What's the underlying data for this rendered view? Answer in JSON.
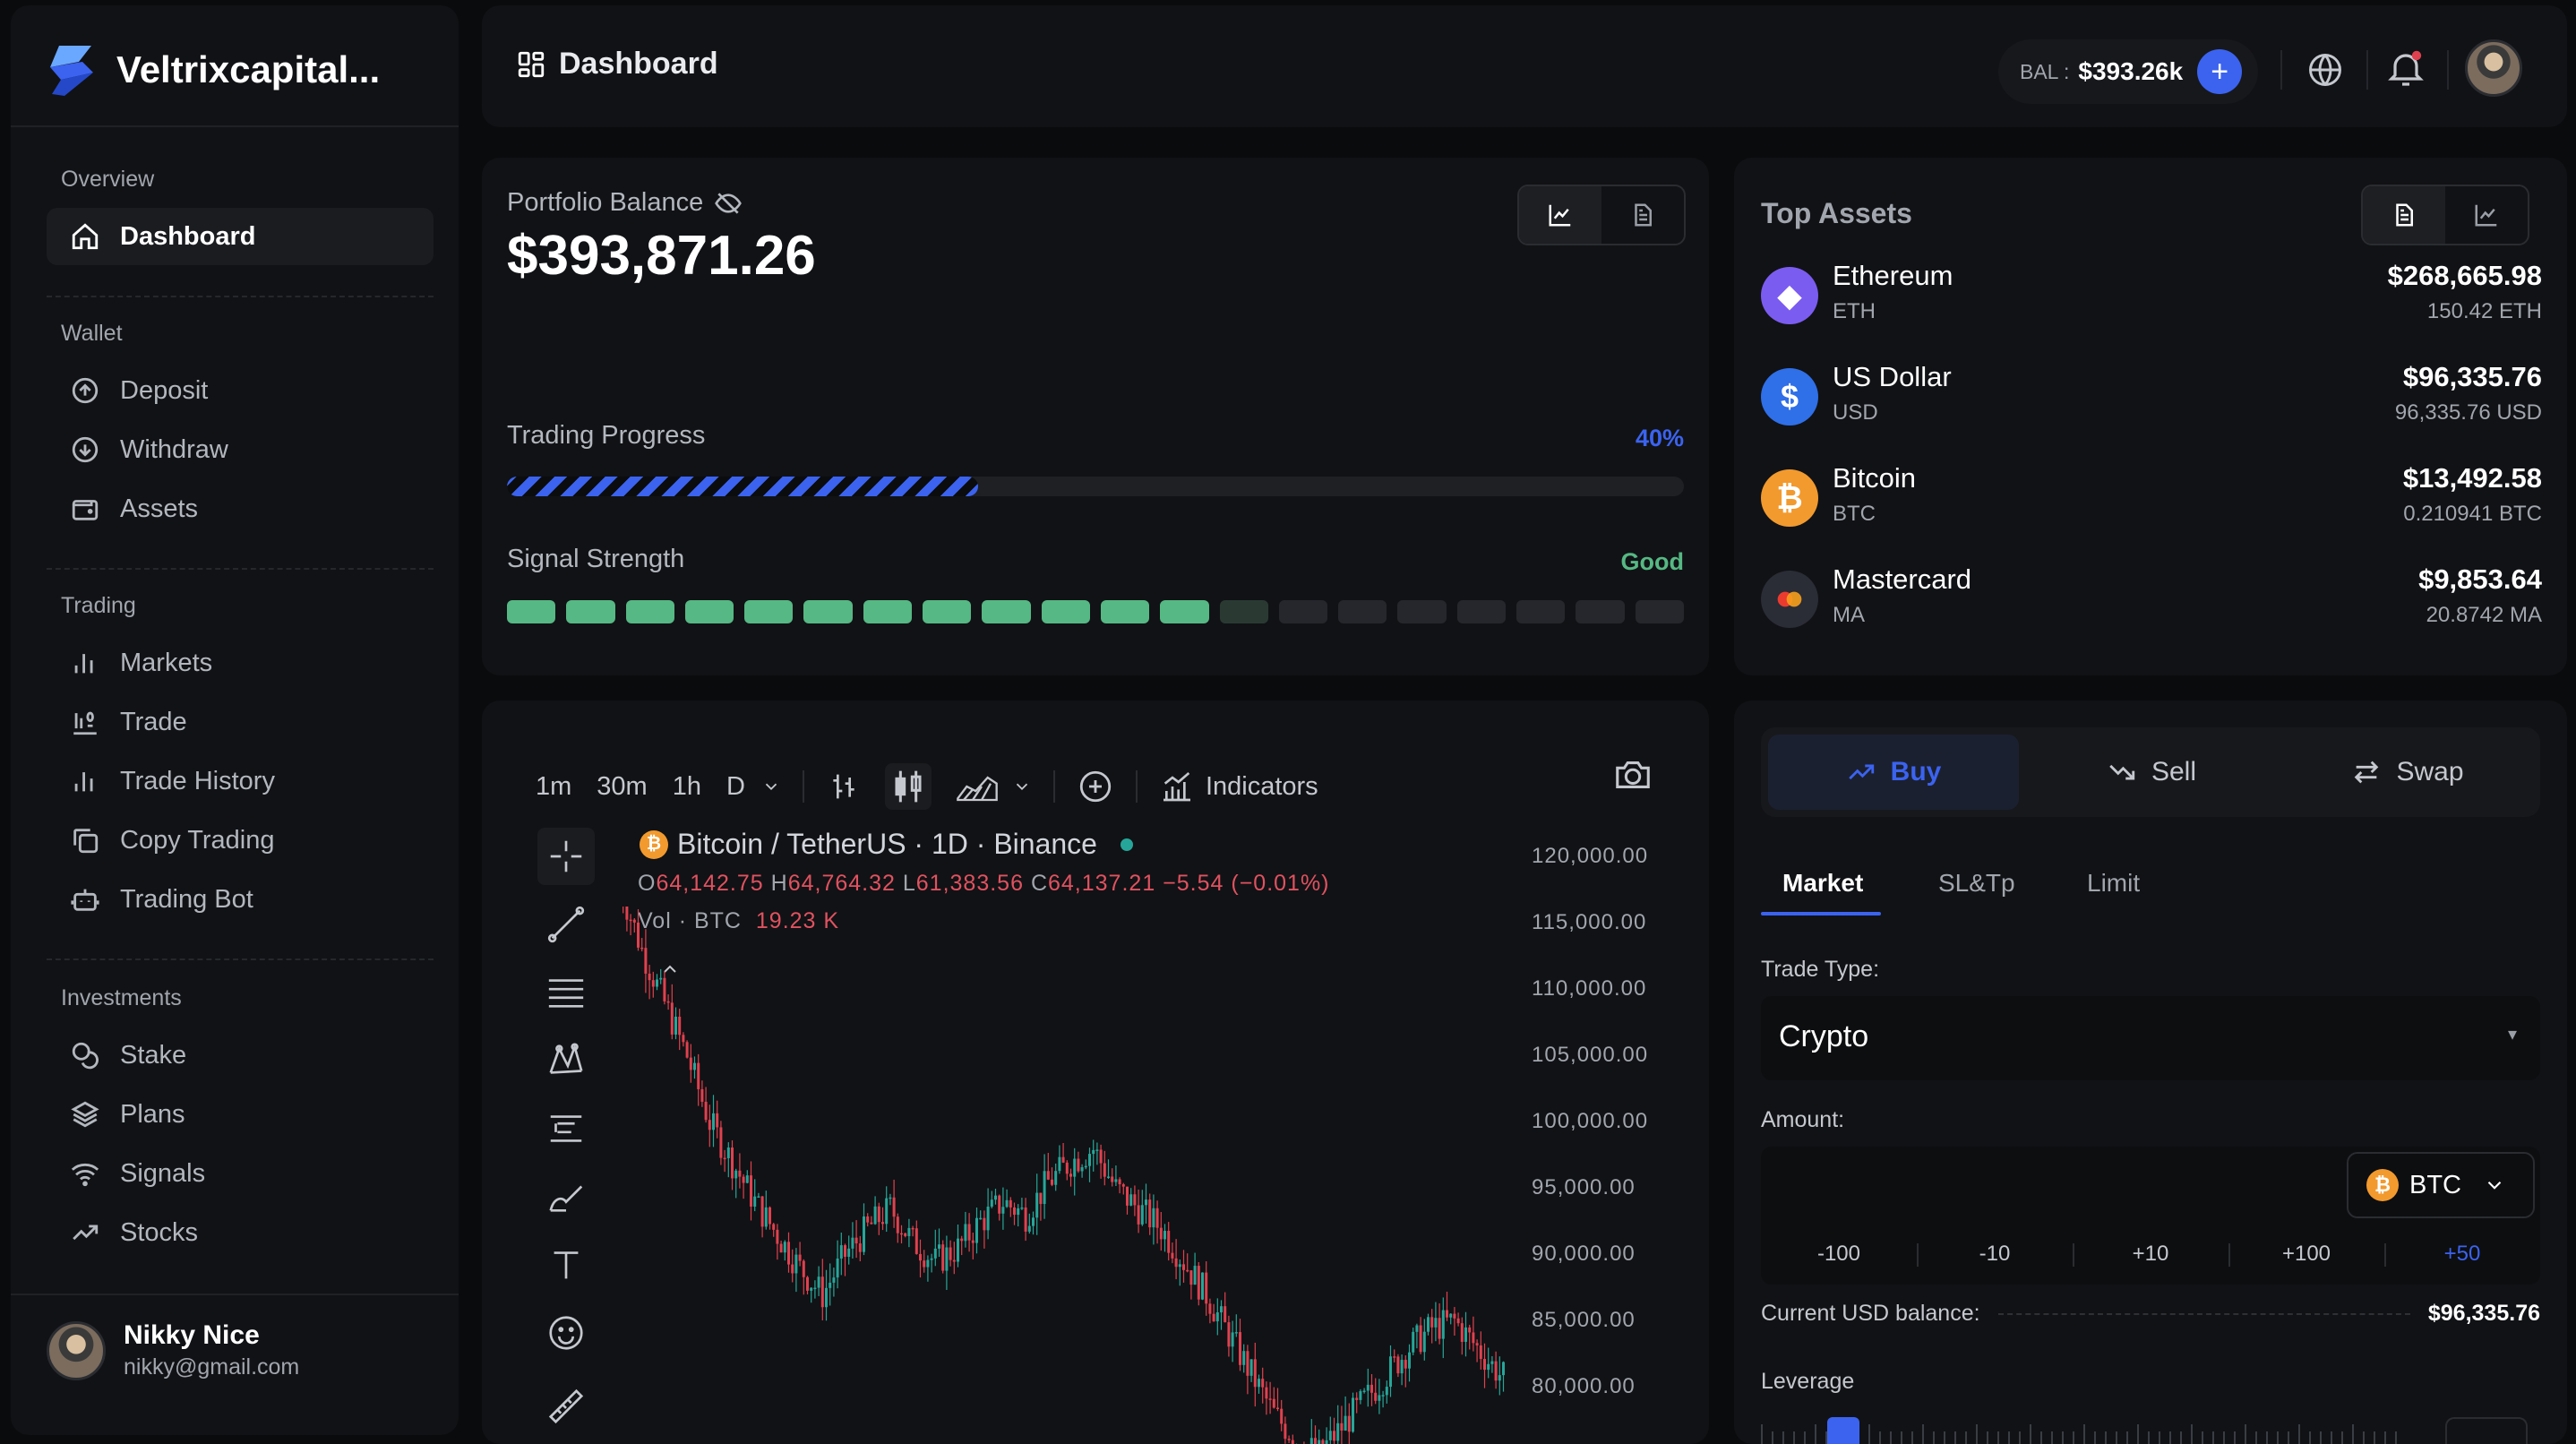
{
  "brand": {
    "name": "Veltrixcapital..."
  },
  "sidebar": {
    "sections": [
      {
        "title": "Overview",
        "items": [
          {
            "label": "Dashboard",
            "icon": "home-icon",
            "active": true
          }
        ]
      },
      {
        "title": "Wallet",
        "items": [
          {
            "label": "Deposit",
            "icon": "deposit-icon"
          },
          {
            "label": "Withdraw",
            "icon": "withdraw-icon"
          },
          {
            "label": "Assets",
            "icon": "wallet-icon"
          }
        ]
      },
      {
        "title": "Trading",
        "items": [
          {
            "label": "Markets",
            "icon": "bar-chart-icon"
          },
          {
            "label": "Trade",
            "icon": "trade-icon"
          },
          {
            "label": "Trade History",
            "icon": "bar-chart-icon"
          },
          {
            "label": "Copy Trading",
            "icon": "copy-icon"
          },
          {
            "label": "Trading Bot",
            "icon": "robot-icon"
          }
        ]
      },
      {
        "title": "Investments",
        "items": [
          {
            "label": "Stake",
            "icon": "coins-icon"
          },
          {
            "label": "Plans",
            "icon": "layers-icon"
          },
          {
            "label": "Signals",
            "icon": "wifi-icon"
          },
          {
            "label": "Stocks",
            "icon": "trending-up-icon"
          }
        ]
      }
    ],
    "user": {
      "name": "Nikky Nice",
      "email": "nikky@gmail.com"
    }
  },
  "header": {
    "title": "Dashboard",
    "balance_label": "BAL :",
    "balance_value": "$393.26k",
    "add_label": "+"
  },
  "portfolio": {
    "label": "Portfolio Balance",
    "value": "$393,871.26",
    "trading_progress_label": "Trading Progress",
    "trading_progress_value": "40%",
    "trading_progress_fraction": 0.4,
    "signal_label": "Signal Strength",
    "signal_value": "Good",
    "signal_lit": 12,
    "signal_total": 20
  },
  "top_assets": {
    "title": "Top Assets",
    "items": [
      {
        "name": "Ethereum",
        "symbol": "ETH",
        "value": "$268,665.98",
        "amount": "150.42 ETH",
        "color": "#7b5cf0",
        "glyph": "◆"
      },
      {
        "name": "US Dollar",
        "symbol": "USD",
        "value": "$96,335.76",
        "amount": "96,335.76 USD",
        "color": "#2f6fe8",
        "glyph": "$"
      },
      {
        "name": "Bitcoin",
        "symbol": "BTC",
        "value": "$13,492.58",
        "amount": "0.210941 BTC",
        "color": "#f29a2e",
        "glyph": "₿"
      },
      {
        "name": "Mastercard",
        "symbol": "MA",
        "value": "$9,853.64",
        "amount": "20.8742 MA",
        "color": "#2a2c36",
        "glyph": "●"
      }
    ]
  },
  "chart": {
    "intervals": [
      "1m",
      "30m",
      "1h",
      "D"
    ],
    "indicators_label": "Indicators",
    "symbol_title": "Bitcoin / TetherUS · 1D · Binance",
    "ohlc": {
      "o_label": "O",
      "o": "64,142.75",
      "h_label": "H",
      "h": "64,764.32",
      "l_label": "L",
      "l": "61,383.56",
      "c_label": "C",
      "c": "64,137.21",
      "change": "−5.54 (−0.01%)"
    },
    "volume": {
      "label": "Vol · BTC",
      "value": "19.23 K"
    },
    "price_labels": [
      "120,000.00",
      "115,000.00",
      "110,000.00",
      "105,000.00",
      "100,000.00",
      "95,000.00",
      "90,000.00",
      "85,000.00",
      "80,000.00"
    ],
    "up_color": "#26a69a",
    "down_color": "#e0414f"
  },
  "trade": {
    "tabs": [
      "Buy",
      "Sell",
      "Swap"
    ],
    "subtabs": [
      "Market",
      "SL&Tp",
      "Limit"
    ],
    "trade_type_label": "Trade Type:",
    "trade_type_value": "Crypto",
    "amount_label": "Amount:",
    "amount_value": "",
    "asset": "BTC",
    "quick_amounts": [
      "-100",
      "-10",
      "+10",
      "+100",
      "+50"
    ],
    "balance_label": "Current USD balance:",
    "balance_value": "$96,335.76",
    "leverage_label": "Leverage"
  },
  "colors": {
    "accent": "#3b63f0",
    "good": "#56b884",
    "panel": "#111215",
    "background": "#0a0b0d"
  }
}
